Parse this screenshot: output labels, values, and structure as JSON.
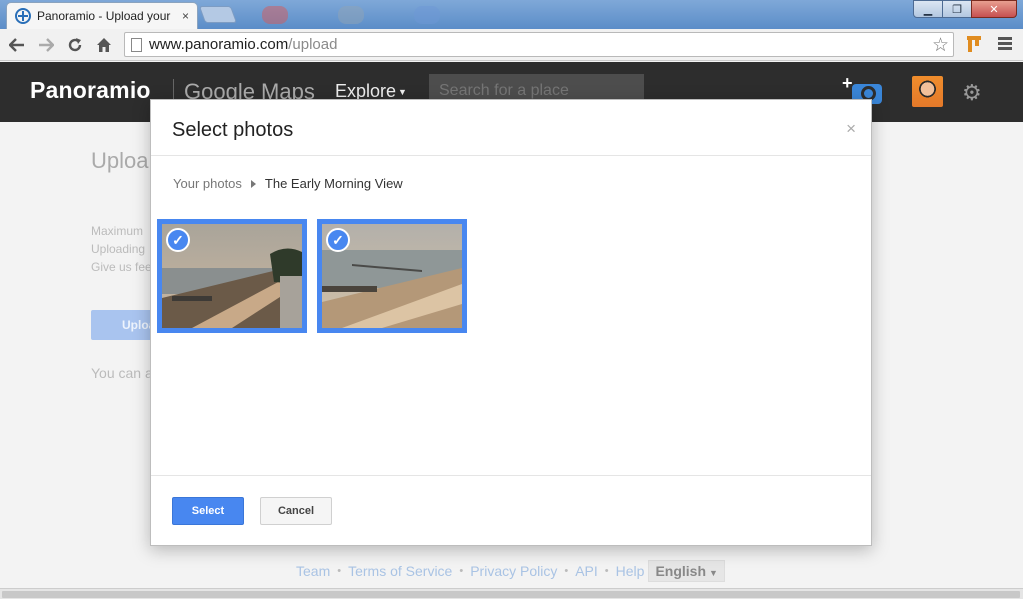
{
  "browser": {
    "tab_title": "Panoramio - Upload your",
    "tab_close": "×",
    "url_host": "www.panoramio.com",
    "url_path": "/upload",
    "window_controls": {
      "minimize": "▁",
      "maximize": "❐",
      "close": "✕"
    }
  },
  "site_header": {
    "logo": "Panoramio",
    "google_maps": "Google Maps",
    "explore": "Explore",
    "search_placeholder": "Search for a place"
  },
  "background_page": {
    "title": "Uploa",
    "line_1": "Maximum",
    "line_2": "Uploading",
    "line_3": "Give us fee",
    "upload_button": "Uploa",
    "you_can": "You can a"
  },
  "dialog": {
    "title": "Select photos",
    "close": "×",
    "breadcrumb": {
      "root": "Your photos",
      "current": "The Early Morning View"
    },
    "photos": [
      {
        "selected": true,
        "check": "✓"
      },
      {
        "selected": true,
        "check": "✓"
      }
    ],
    "select_label": "Select",
    "cancel_label": "Cancel"
  },
  "footer": {
    "links": [
      "Team",
      "Terms of Service",
      "Privacy Policy",
      "API",
      "Help"
    ],
    "separator": "•",
    "language": "English"
  },
  "colors": {
    "accent": "#4887f0",
    "header_bg": "#2d2d2d",
    "footer_link": "#a9c3e4"
  }
}
